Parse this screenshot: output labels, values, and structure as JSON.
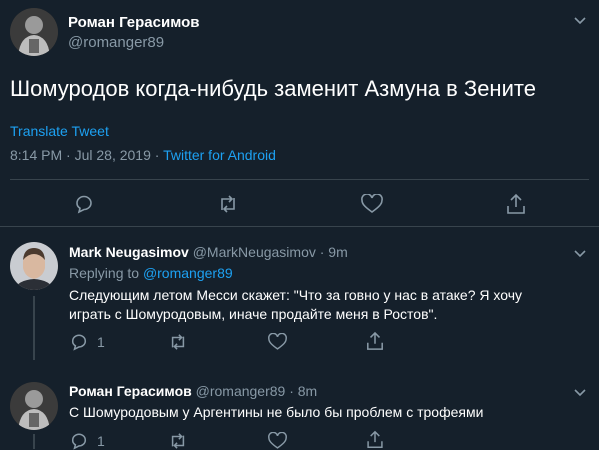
{
  "main_tweet": {
    "author_name": "Роман Герасимов",
    "author_handle": "@romanger89",
    "text": "Шомуродов когда-нибудь заменит Азмуна в Зените",
    "translate_label": "Translate Tweet",
    "time": "8:14 PM · Jul 28, 2019 · ",
    "source": "Twitter for Android",
    "icons": [
      "reply-icon",
      "retweet-icon",
      "like-icon",
      "share-icon"
    ]
  },
  "replies": [
    {
      "author_name": "Mark Neugasimov",
      "author_handle": "@MarkNeugasimov · 9m",
      "replying_prefix": "Replying to ",
      "replying_to": "@romanger89",
      "text_line1": "Следующим летом Месси скажет: \"Что за говно у нас в атаке? Я хочу",
      "text_line2": "играть с Шомуродовым, иначе продайте меня в Ростов\".",
      "reply_count": "1"
    },
    {
      "author_name": "Роман Герасимов",
      "author_handle": "@romanger89 · 8m",
      "text_line1": "С Шомуродовым у Аргентины не было бы проблем с трофеями",
      "reply_count": "1"
    }
  ],
  "colors": {
    "background": "#15202b",
    "accent": "#1da1f2",
    "muted": "#8899a6",
    "divider": "#38444d"
  }
}
